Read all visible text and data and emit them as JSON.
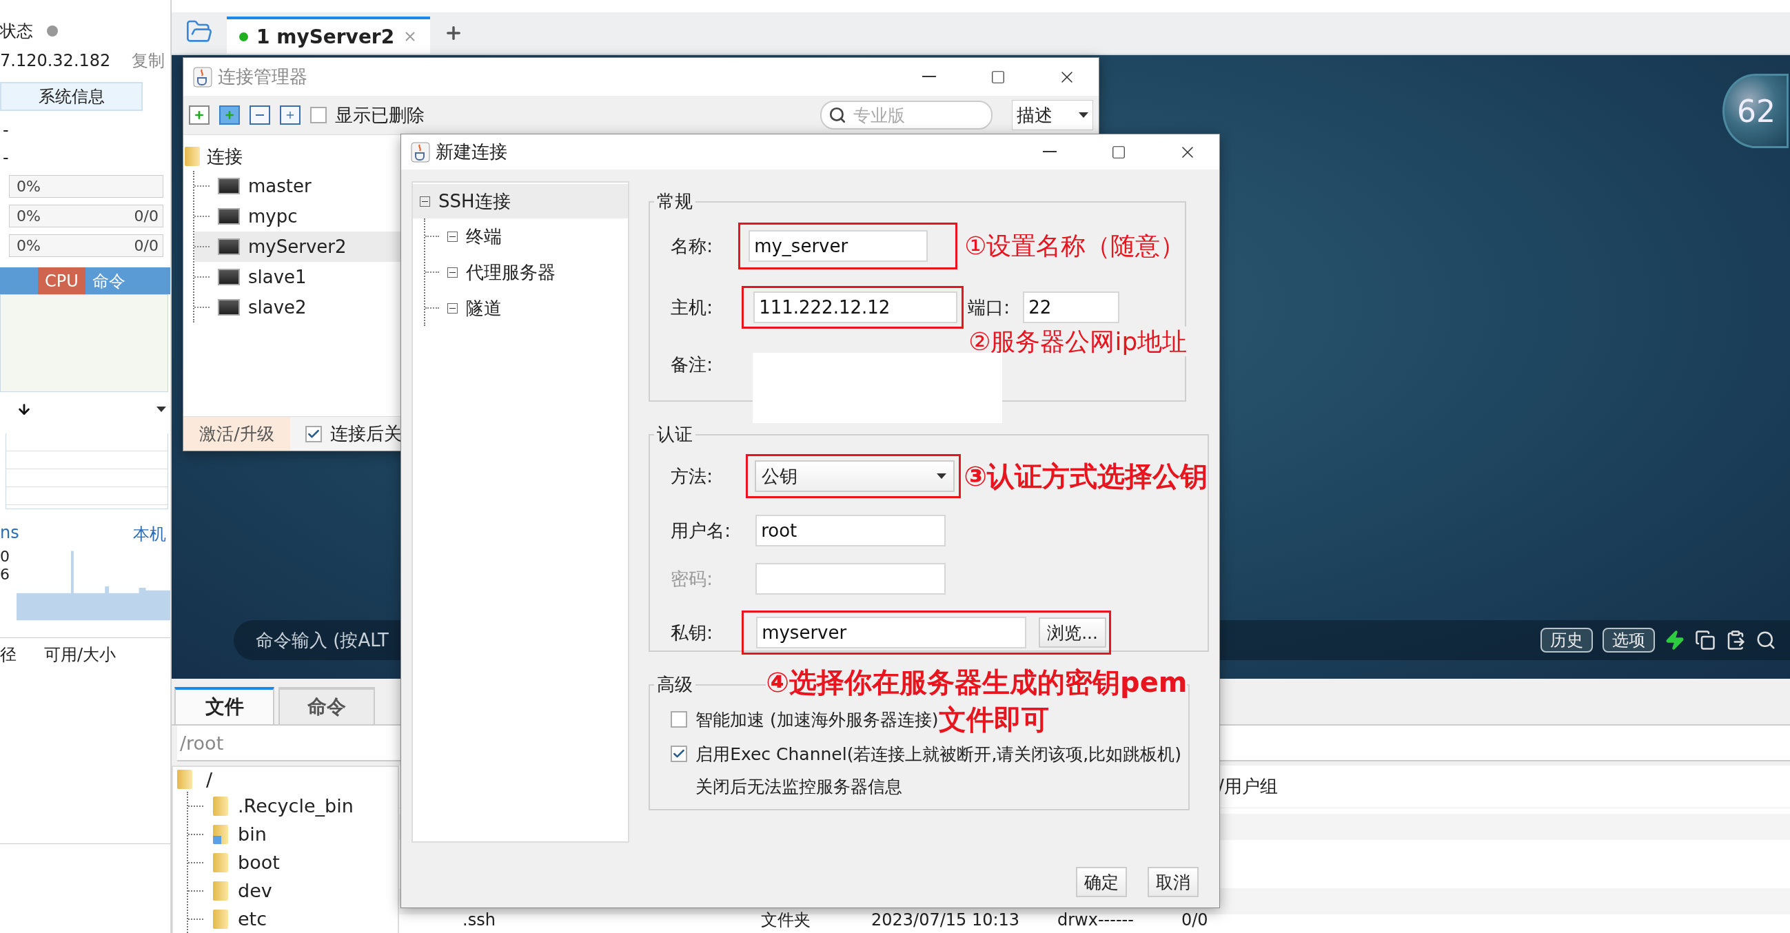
{
  "sidebar": {
    "status_label": "状态",
    "status_online": false,
    "ip": "7.120.32.182",
    "copy_link": "复制",
    "sysinfo_button": "系统信息",
    "info_rows": [
      "-",
      "-"
    ],
    "meters": [
      {
        "reading": "0%",
        "level": 0
      },
      {
        "reading": "0%",
        "count": "0/0",
        "level": 0
      },
      {
        "reading": "0%",
        "count": "0/0",
        "level": 0
      }
    ],
    "tabs": [
      {
        "label": "CPU",
        "selected": true
      },
      {
        "label": "命令",
        "selected": false
      }
    ],
    "network": {
      "label": "ns",
      "host": "本机",
      "ticks": [
        "0",
        "6"
      ]
    },
    "disk_columns": [
      "径",
      "可用/大小"
    ]
  },
  "tabbar": {
    "tabs": [
      {
        "label": "1 myServer2",
        "connected": true,
        "selected": true
      }
    ]
  },
  "terminal": {
    "command_placeholder": "命令输入 (按ALT",
    "buttons": [
      "历史",
      "选项"
    ],
    "avatar_text": "62"
  },
  "connection_manager": {
    "title": "连接管理器",
    "show_deleted": {
      "label": "显示已删除",
      "checked": false
    },
    "search_placeholder": "专业版",
    "sort": "描述",
    "tree": {
      "label": "连接",
      "children": [
        {
          "label": "master",
          "selected": false
        },
        {
          "label": "mypc",
          "selected": false
        },
        {
          "label": "myServer2",
          "selected": true
        },
        {
          "label": "slave1",
          "selected": false
        },
        {
          "label": "slave2",
          "selected": false
        }
      ]
    },
    "upgrade": "激活/升级",
    "close_after": {
      "label": "连接后关",
      "checked": true
    }
  },
  "new_connection": {
    "title": "新建连接",
    "nav": {
      "label": "SSH连接",
      "selected": true,
      "children": [
        {
          "label": "终端",
          "selected": false
        },
        {
          "label": "代理服务器",
          "selected": false
        },
        {
          "label": "隧道",
          "selected": false
        }
      ]
    },
    "general": {
      "title": "常规",
      "name": {
        "label": "名称:",
        "value": "my_server"
      },
      "host": {
        "label": "主机:",
        "value": "111.222.12.12"
      },
      "port": {
        "label": "端口:",
        "value": "22"
      },
      "note": {
        "label": "备注:"
      }
    },
    "auth": {
      "title": "认证",
      "method": {
        "label": "方法:",
        "value": "公钥"
      },
      "username": {
        "label": "用户名:",
        "value": "root"
      },
      "password": {
        "label": "密码:",
        "disabled": true
      },
      "private_key": {
        "label": "私钥:",
        "value": "myserver"
      },
      "browse": "浏览..."
    },
    "advanced": {
      "title": "高级",
      "options": [
        {
          "label": "智能加速 (加速海外服务器连接)",
          "checked": false
        },
        {
          "label": "启用Exec Channel(若连接上就被断开,请关闭该项,比如跳板机)",
          "checked": true
        }
      ],
      "note": "关闭后无法监控服务器信息"
    },
    "buttons": [
      "确定",
      "取消"
    ]
  },
  "annotations": [
    {
      "text": "①设置名称（随意）",
      "bold": false
    },
    {
      "text": "②服务器公网ip地址",
      "bold": false
    },
    {
      "text": "③认证方式选择公钥",
      "bold": true
    },
    {
      "text": "④选择你在服务器生成的密钥pem",
      "bold": true
    },
    {
      "text": "文件即可",
      "bold": true
    }
  ],
  "files": {
    "tabs": [
      {
        "label": "文件",
        "selected": true
      },
      {
        "label": "命令",
        "selected": false
      }
    ],
    "path": "/root",
    "tree": {
      "label": "/",
      "children": [
        {
          "label": ".Recycle_bin",
          "kind": "folder"
        },
        {
          "label": "bin",
          "kind": "link"
        },
        {
          "label": "boot",
          "kind": "folder"
        },
        {
          "label": "dev",
          "kind": "folder"
        },
        {
          "label": "etc",
          "kind": "folder"
        }
      ]
    },
    "columns": [
      "/用户组"
    ],
    "rows": [
      {
        "name": ".ssh",
        "type": "文件夹",
        "modified": "2023/07/15 10:13",
        "permissions": "drwx------",
        "owner": "0/0"
      }
    ]
  }
}
